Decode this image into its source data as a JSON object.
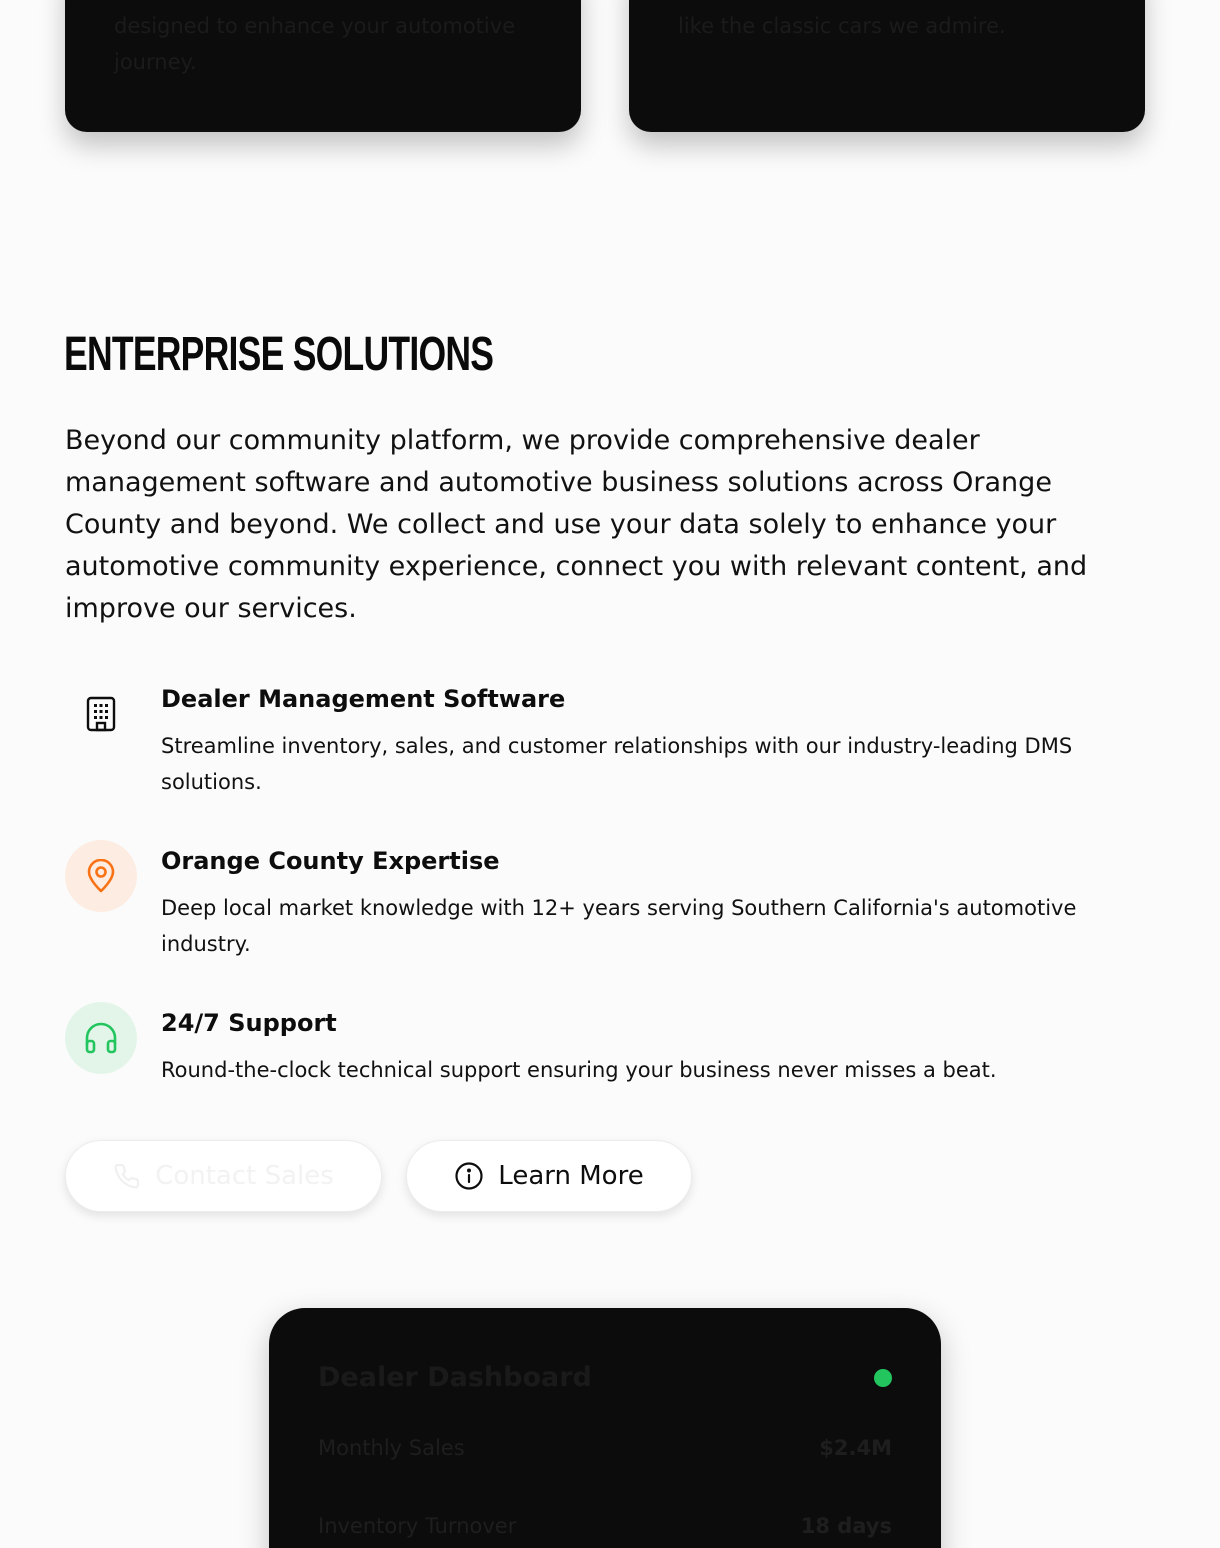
{
  "top_cards": {
    "left_text": "designed to enhance your automotive journey.",
    "right_text": "like the classic cars we admire."
  },
  "section": {
    "title": "ENTERPRISE SOLUTIONS",
    "lead": "Beyond our community platform, we provide comprehensive dealer management software and automotive business solutions across Orange County and beyond. We collect and use your data solely to enhance your automotive community experience, connect you with relevant content, and improve our services."
  },
  "features": [
    {
      "icon": "building-icon",
      "title": "Dealer Management Software",
      "description": "Streamline inventory, sales, and customer relationships with our industry-leading DMS solutions.",
      "icon_color": "#0d0d0d",
      "icon_bg": "#fbfbfb"
    },
    {
      "icon": "map-pin-icon",
      "title": "Orange County Expertise",
      "description": "Deep local market knowledge with 12+ years serving Southern California's automotive industry.",
      "icon_color": "#f97316",
      "icon_bg": "#fdece1"
    },
    {
      "icon": "headphones-icon",
      "title": "24/7 Support",
      "description": "Round-the-clock technical support ensuring your business never misses a beat.",
      "icon_color": "#22c55e",
      "icon_bg": "#e3f5e9"
    }
  ],
  "buttons": {
    "contact_label": "Contact Sales",
    "learn_label": "Learn More"
  },
  "dashboard": {
    "title": "Dealer Dashboard",
    "status_color": "#22c55e",
    "rows": [
      {
        "label": "Monthly Sales",
        "value": "$2.4M"
      },
      {
        "label": "Inventory Turnover",
        "value": "18 days"
      }
    ]
  }
}
